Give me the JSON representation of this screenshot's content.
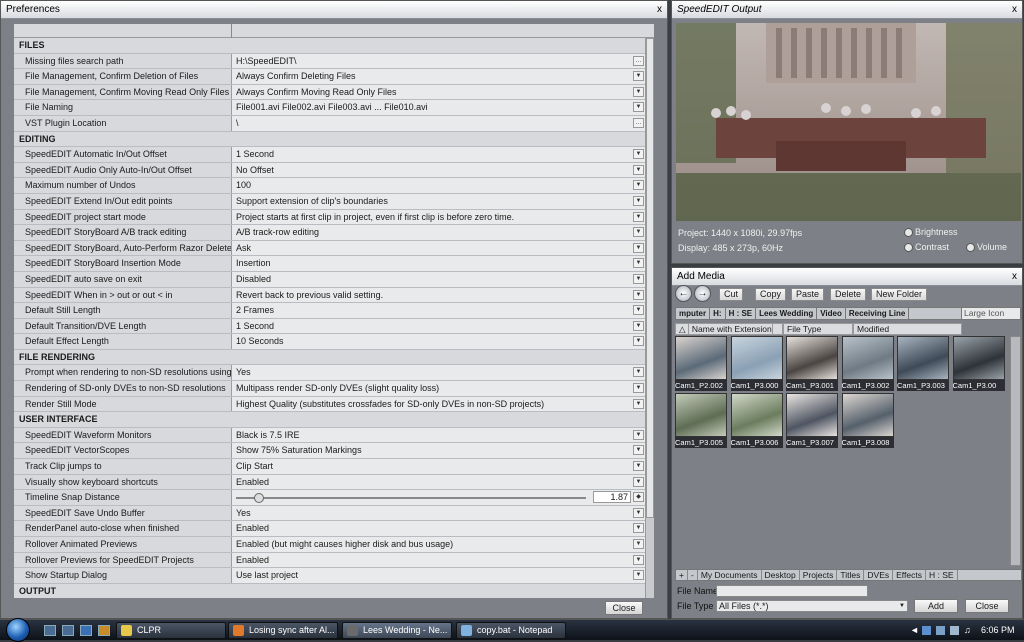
{
  "preferences": {
    "title": "Preferences",
    "close_x": "x",
    "close_label": "Close",
    "rows": [
      {
        "type": "section",
        "label": "FILES"
      },
      {
        "label": "Missing files search path",
        "value": "H:\\SpeedEDIT\\",
        "control": "browse"
      },
      {
        "label": "File Management, Confirm Deletion of Files",
        "value": "Always Confirm Deleting Files",
        "control": "dropdown"
      },
      {
        "label": "File Management, Confirm Moving Read Only Files",
        "value": "Always Confirm Moving Read Only Files",
        "control": "dropdown"
      },
      {
        "label": "File Naming",
        "value": "File001.avi File002.avi File003.avi ... File010.avi",
        "control": "dropdown"
      },
      {
        "label": "VST Plugin Location",
        "value": "\\",
        "control": "browse"
      },
      {
        "type": "section",
        "label": "EDITING"
      },
      {
        "label": "SpeedEDIT Automatic In/Out Offset",
        "value": "1 Second",
        "control": "dropdown"
      },
      {
        "label": "SpeedEDIT Audio Only Auto-In/Out Offset",
        "value": "No Offset",
        "control": "dropdown"
      },
      {
        "label": "Maximum number of Undos",
        "value": "100",
        "control": "dropdown"
      },
      {
        "label": "SpeedEDIT Extend In/Out edit points",
        "value": "Support extension of clip's boundaries",
        "control": "dropdown"
      },
      {
        "label": "SpeedEDIT project start mode",
        "value": "Project starts at first clip in project, even if first clip is before zero time.",
        "control": "dropdown"
      },
      {
        "label": "SpeedEDIT StoryBoard A/B track editing",
        "value": "A/B track-row editing",
        "control": "dropdown"
      },
      {
        "label": "SpeedEDIT StoryBoard, Auto-Perform Razor Delete",
        "value": "Ask",
        "control": "dropdown"
      },
      {
        "label": "SpeedEDIT StoryBoard Insertion Mode",
        "value": "Insertion",
        "control": "dropdown"
      },
      {
        "label": "SpeedEDIT auto save on exit",
        "value": "Disabled",
        "control": "dropdown"
      },
      {
        "label": "SpeedEDIT When in > out or out < in",
        "value": "Revert back to previous valid setting.",
        "control": "dropdown"
      },
      {
        "label": "Default Still Length",
        "value": "2 Frames",
        "control": "dropdown"
      },
      {
        "label": "Default Transition/DVE Length",
        "value": "1 Second",
        "control": "dropdown"
      },
      {
        "label": "Default Effect Length",
        "value": "10 Seconds",
        "control": "dropdown"
      },
      {
        "type": "section",
        "label": "FILE RENDERING"
      },
      {
        "label": "Prompt when rendering to non-SD resolutions using",
        "value": "Yes",
        "control": "dropdown"
      },
      {
        "label": "Rendering of SD-only DVEs to non-SD resolutions",
        "value": "Multipass render SD-only DVEs (slight quality loss)",
        "control": "dropdown"
      },
      {
        "label": "Render Still Mode",
        "value": "Highest Quality (substitutes crossfades for SD-only DVEs in non-SD projects)",
        "control": "dropdown"
      },
      {
        "type": "section",
        "label": "USER INTERFACE"
      },
      {
        "label": "SpeedEDIT Waveform Monitors",
        "value": "Black is 7.5 IRE",
        "control": "dropdown"
      },
      {
        "label": "SpeedEDIT VectorScopes",
        "value": "Show 75% Saturation Markings",
        "control": "dropdown"
      },
      {
        "label": "Track Clip jumps to",
        "value": "Clip Start",
        "control": "dropdown"
      },
      {
        "label": "Visually show keyboard shortcuts",
        "value": "Enabled",
        "control": "dropdown"
      },
      {
        "label": "Timeline Snap Distance",
        "value": "1.87",
        "control": "slider",
        "level": 0.05
      },
      {
        "label": "SpeedEDIT Save Undo Buffer",
        "value": "Yes",
        "control": "dropdown"
      },
      {
        "label": "RenderPanel auto-close when finished",
        "value": "Enabled",
        "control": "dropdown"
      },
      {
        "label": "Rollover Animated Previews",
        "value": "Enabled (but might causes higher disk and bus usage)",
        "control": "dropdown"
      },
      {
        "label": "Rollover Previews for SpeedEDIT Projects",
        "value": "Enabled",
        "control": "dropdown"
      },
      {
        "label": "Show Startup Dialog",
        "value": "Use last project",
        "control": "dropdown"
      },
      {
        "type": "section",
        "label": "OUTPUT"
      }
    ]
  },
  "output": {
    "title": "SpeedEDIT Output",
    "close_x": "x",
    "project": "Project: 1440 x 1080i, 29.97fps",
    "display": "Display: 485 x 273p, 60Hz",
    "brightness": "Brightness",
    "contrast": "Contrast",
    "volume": "Volume"
  },
  "add_media": {
    "title": "Add Media",
    "close_x": "x",
    "toolbar": {
      "cut": "Cut",
      "copy": "Copy",
      "paste": "Paste",
      "delete": "Delete",
      "new_folder": "New Folder"
    },
    "crumbs": [
      "mputer",
      "H:",
      "H : SE",
      "Lees Wedding",
      "Video",
      "Receiving Line"
    ],
    "view_mode": "Large Icon",
    "columns": [
      "Name with Extension",
      "File Type",
      "Modified"
    ],
    "thumbnails": [
      "Cam1_P2.002",
      "Cam1_P3.000",
      "Cam1_P3.001",
      "Cam1_P3.002",
      "Cam1_P3.003",
      "Cam1_P3.00",
      "Cam1_P3.005",
      "Cam1_P3.006",
      "Cam1_P3.007",
      "Cam1_P3.008"
    ],
    "locations": [
      "+",
      "-",
      "My Documents",
      "Desktop",
      "Projects",
      "Titles",
      "DVEs",
      "Effects",
      "H : SE"
    ],
    "file_name_label": "File Name",
    "file_name_value": "",
    "file_type_label": "File Type",
    "file_type_value": "All Files (*.*)",
    "add_label": "Add",
    "close_label": "Close"
  },
  "taskbar": {
    "tasks": [
      {
        "label": "CLPR",
        "color": "#e8c84a"
      },
      {
        "label": "Losing sync after Al...",
        "color": "#e07a2a"
      },
      {
        "label": "Lees Wedding - Ne...",
        "color": "#6a6a6a"
      },
      {
        "label": "copy.bat - Notepad",
        "color": "#7fb2e0"
      }
    ],
    "clock": "6:06 PM"
  }
}
